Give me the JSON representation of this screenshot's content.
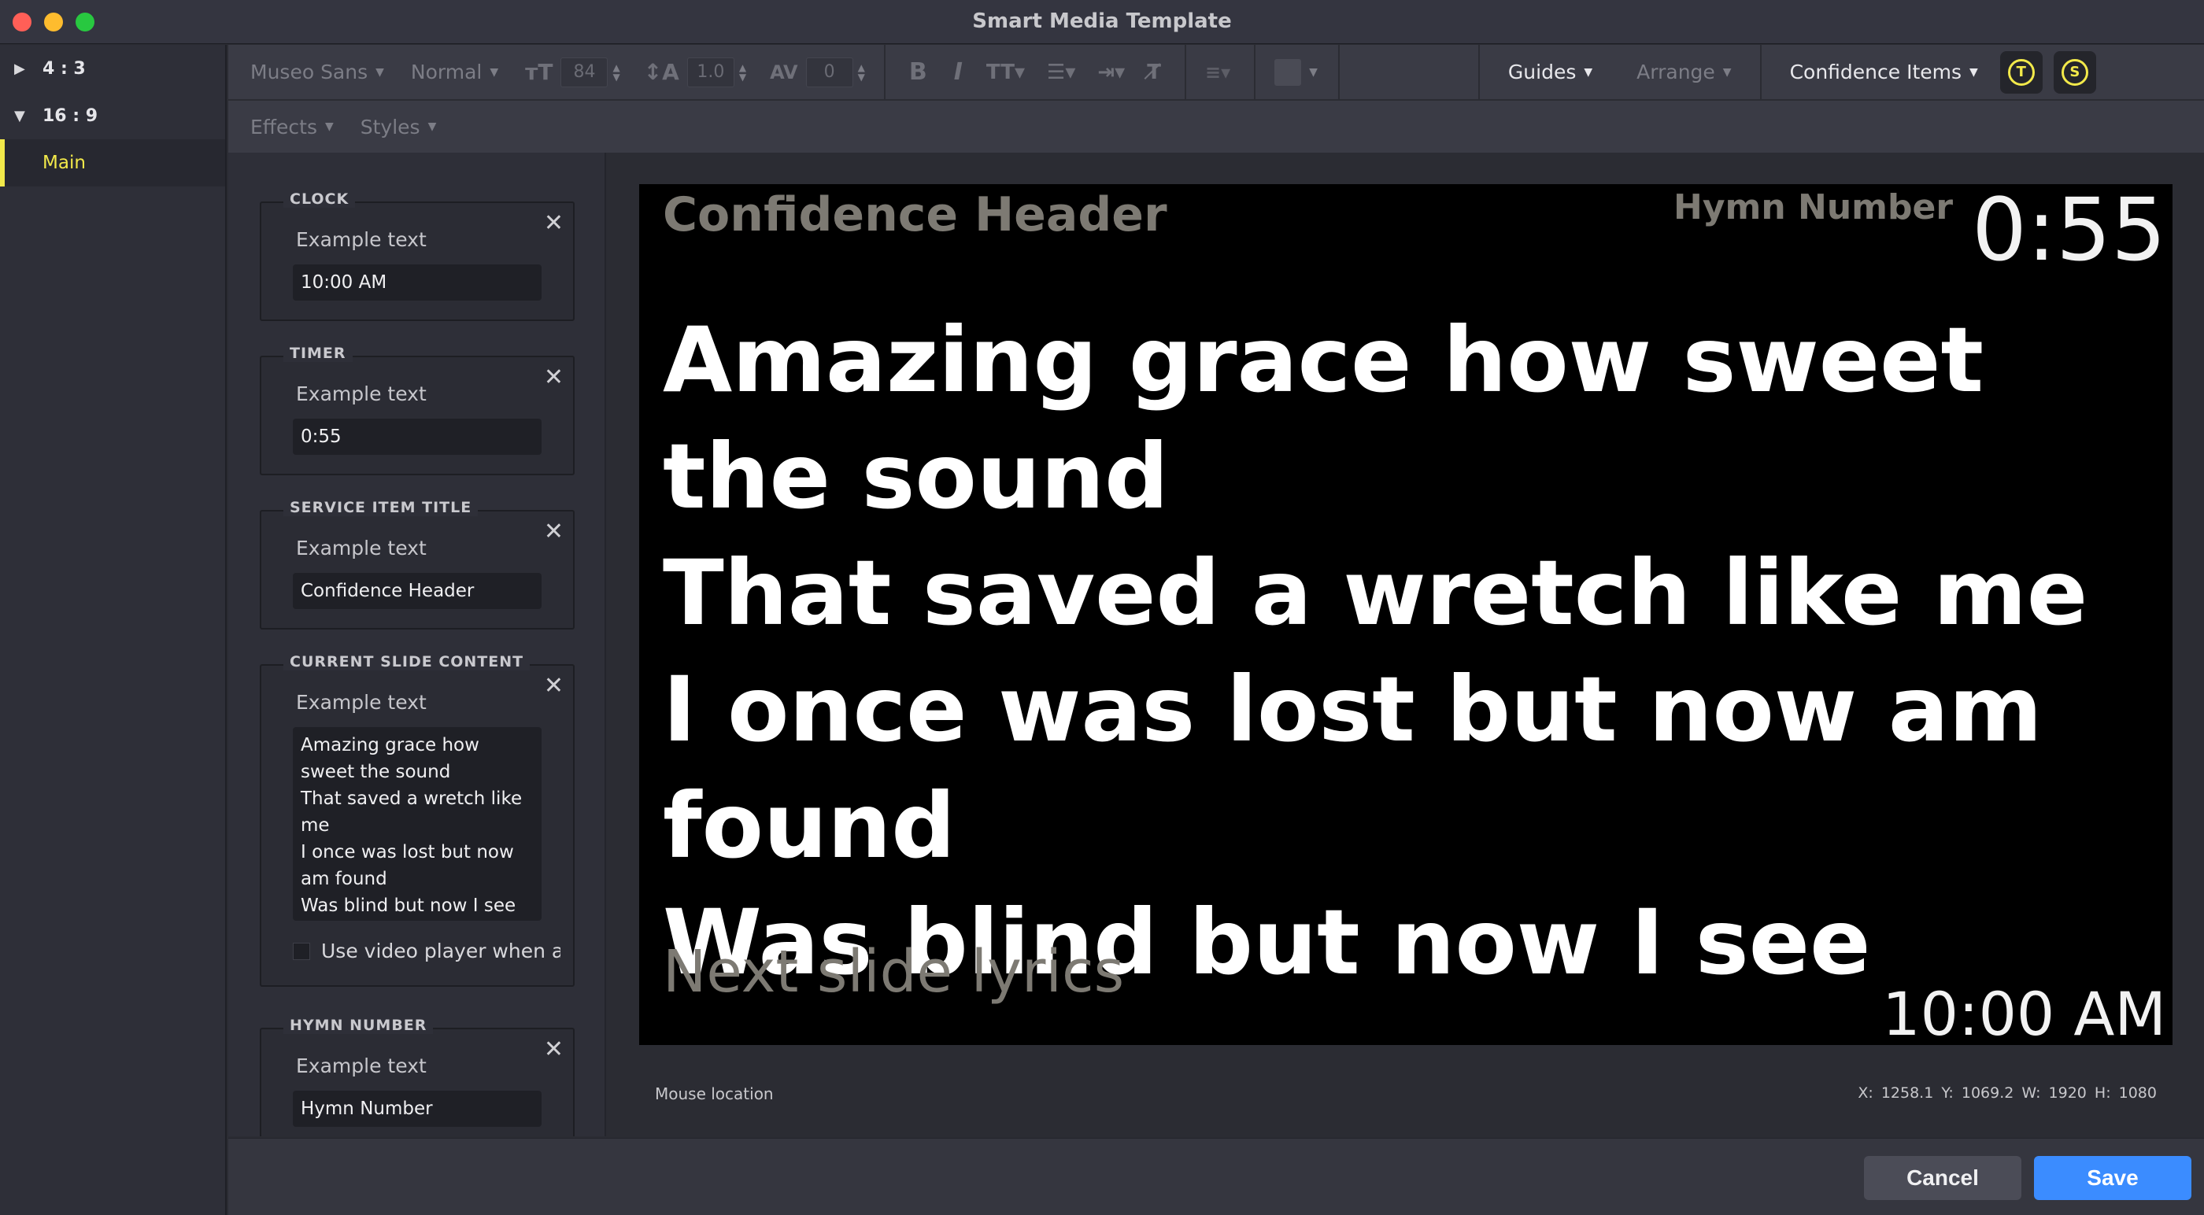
{
  "window": {
    "title": "Smart Media Template"
  },
  "sidebar": {
    "ratios": [
      {
        "label": "4 : 3",
        "expanded": false
      },
      {
        "label": "16 : 9",
        "expanded": true
      }
    ],
    "selected_item": "Main"
  },
  "toolbar": {
    "font_family": "Museo Sans",
    "font_weight": "Normal",
    "font_size": "84",
    "line_height": "1.0",
    "character_spacing": "0",
    "guides_label": "Guides",
    "arrange_label": "Arrange",
    "confidence_items_label": "Confidence Items",
    "effects_label": "Effects",
    "styles_label": "Styles"
  },
  "properties": [
    {
      "label": "CLOCK",
      "caption": "Example text",
      "value": "10:00 AM"
    },
    {
      "label": "TIMER",
      "caption": "Example text",
      "value": "0:55"
    },
    {
      "label": "SERVICE ITEM TITLE",
      "caption": "Example text",
      "value": "Confidence Header"
    },
    {
      "label": "CURRENT SLIDE CONTENT",
      "caption": "Example text",
      "value": "Amazing grace how sweet the sound\nThat saved a wretch like me\nI once was lost but now am found\nWas blind but now I see",
      "checkbox_label": "Use video player when a"
    },
    {
      "label": "HYMN NUMBER",
      "caption": "Example text",
      "value": "Hymn Number"
    }
  ],
  "slide": {
    "header": "Confidence Header",
    "hymn_number": "Hymn Number",
    "timer": "0:55",
    "lyrics": "Amazing grace how sweet the sound\nThat saved a wretch like me\nI once was lost but now am found\nWas blind but now I see",
    "next_lyrics": "Next slide lyrics",
    "clock": "10:00 AM"
  },
  "status": {
    "mouse_label": "Mouse location",
    "coords": "X: 1258.1  Y: 1069.2    W: 1920  H: 1080"
  },
  "footer": {
    "cancel_label": "Cancel",
    "save_label": "Save"
  },
  "colors": {
    "accent_yellow": "#f2e94a",
    "save_blue": "#3b8cff"
  }
}
